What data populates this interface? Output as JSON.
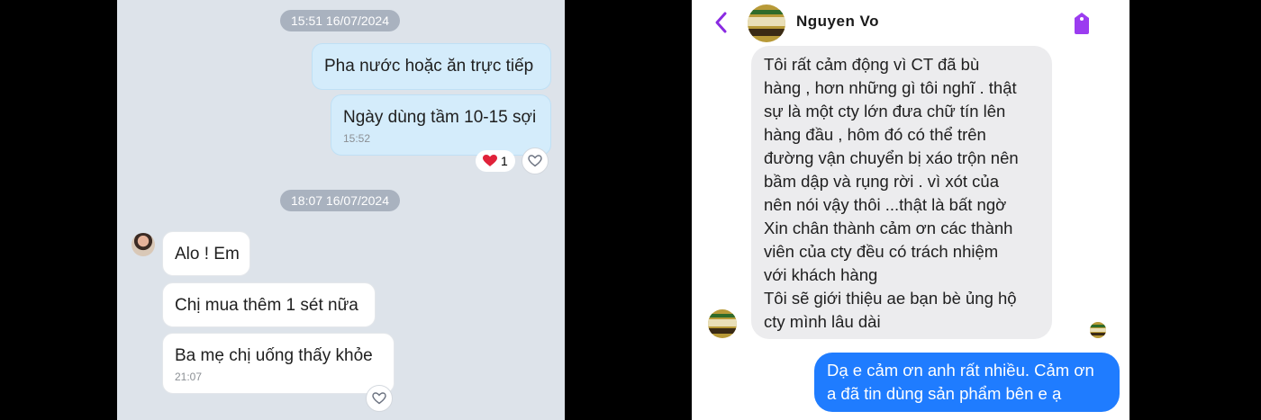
{
  "left_chat": {
    "timestamp_1": "15:51 16/07/2024",
    "msg_out_1": "Pha nước hoặc ăn trực tiếp",
    "msg_out_2": "Ngày dùng tầm 10-15 sợi",
    "msg_out_2_time": "15:52",
    "reaction_count": "1",
    "timestamp_2": "18:07 16/07/2024",
    "msg_in_1": "Alo ! Em",
    "msg_in_2": "Chị mua thêm 1 sét nữa",
    "msg_in_3": "Ba mẹ chị uống thấy khỏe",
    "msg_in_3_time": "21:07",
    "colors": {
      "outgoing": "#d4ecfb",
      "incoming": "#ffffff",
      "background": "#dde3ea"
    }
  },
  "right_chat": {
    "contact_name": "Nguyen Vo",
    "incoming_lines": [
      "Tôi rất cảm động vì CT đã bù",
      "hàng , hơn những gì tôi nghĩ . thật",
      "sự là một cty lớn đưa chữ tín lên",
      "hàng đầu , hôm đó có thể trên",
      "đường vận chuyển bị xáo trộn nên",
      "bầm dập và rụng rời . vì xót của",
      "nên nói vậy thôi ...thật là bất ngờ",
      "Xin chân thành cảm ơn các thành",
      "viên của cty đều có trách nhiệm",
      "với khách hàng",
      "Tôi sẽ giới thiệu ae bạn bè ủng hộ",
      "cty mình lâu dài"
    ],
    "outgoing_lines": [
      "Dạ e cảm ơn anh rất nhiều. Cảm ơn",
      "a đã tin dùng sản phẩm bên e ạ"
    ],
    "icons": [
      "back-chevron-icon",
      "tag-icon"
    ],
    "colors": {
      "accent": "#8a2be2",
      "outgoing": "#1f7cff",
      "incoming": "#ececee"
    }
  }
}
